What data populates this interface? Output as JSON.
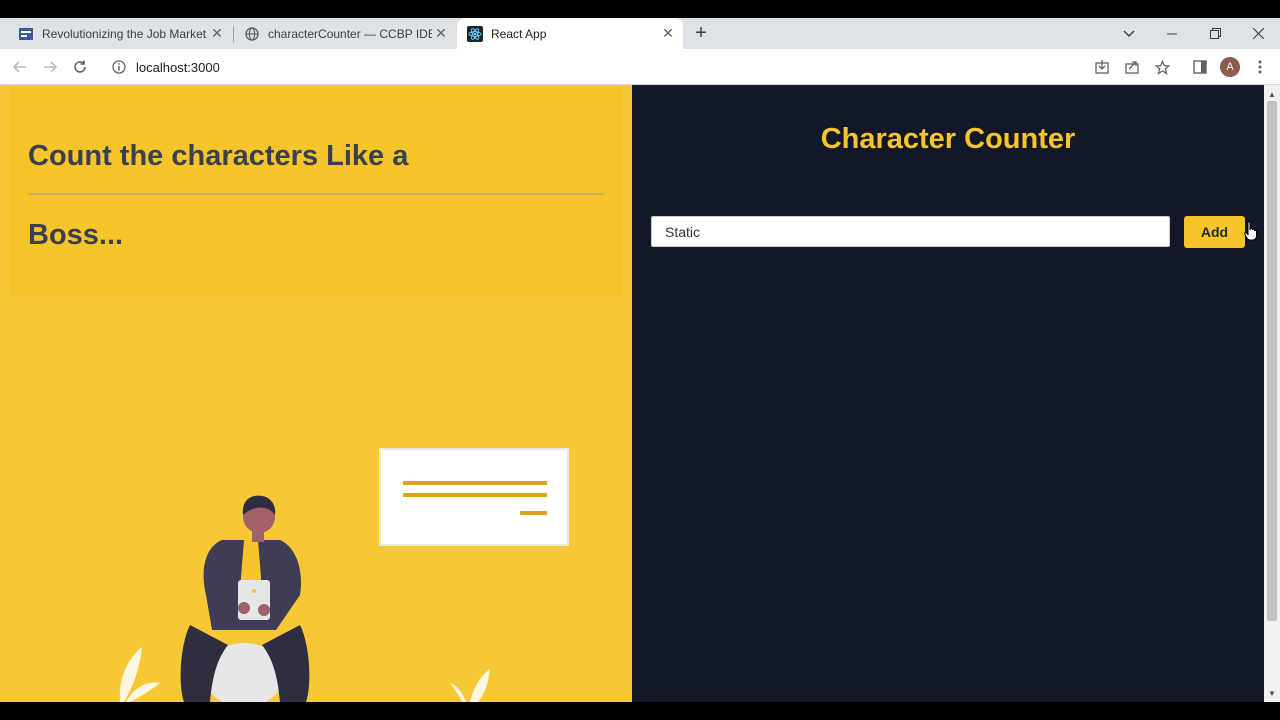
{
  "browser": {
    "tabs": [
      {
        "title": "Revolutionizing the Job Market |",
        "icon": "site-favicon",
        "close": "✕"
      },
      {
        "title": "characterCounter — CCBP IDE",
        "icon": "globe-icon",
        "close": "✕"
      },
      {
        "title": "React App",
        "icon": "react-icon",
        "close": "✕"
      }
    ],
    "new_tab": "+",
    "url": "localhost:3000",
    "profile_initial": "A"
  },
  "hero": {
    "line1": "Count the characters Like a",
    "line2": "Boss..."
  },
  "app": {
    "title": "Character Counter",
    "input_value": "Static",
    "add_label": "Add"
  },
  "colors": {
    "left_bg": "#f7c836",
    "right_bg": "#121828",
    "accent": "#f7c42a"
  }
}
